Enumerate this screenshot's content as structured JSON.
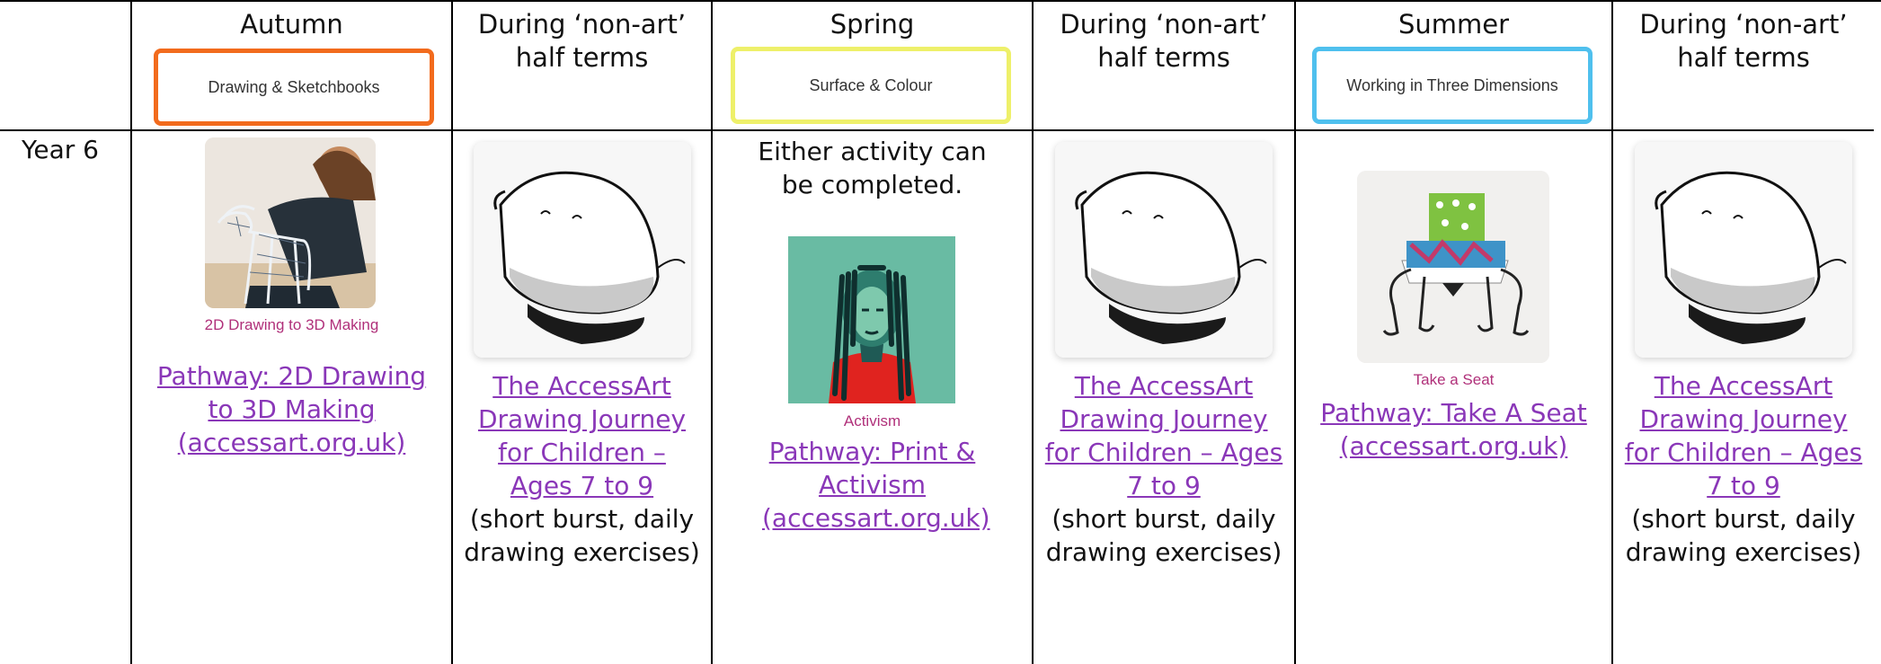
{
  "row_label": "Year 6",
  "columns": [
    {
      "title": "Autumn",
      "badge": "Drawing & Sketchbooks",
      "badge_color": "#f26b1d",
      "image_icon": "girl-with-wire-dog-sculpture",
      "caption": "2D Drawing to 3D Making",
      "link": "Pathway: 2D Drawing to 3D Making (accessart.org.uk)"
    },
    {
      "title": "During ‘non-art’ half terms",
      "image_icon": "ink-drawing-blob",
      "link": "The AccessArt Drawing Journey for Children – Ages 7 to 9",
      "note": "(short burst, daily drawing exercises)"
    },
    {
      "title": "Spring",
      "badge": "Surface & Colour",
      "badge_color": "#eef06a",
      "intro": "Either activity can be completed.",
      "image_icon": "activism-portrait-print",
      "caption": "Activism",
      "link": "Pathway: Print & Activism (accessart.org.uk)"
    },
    {
      "title": "During ‘non-art’ half terms",
      "image_icon": "ink-drawing-blob",
      "link": "The AccessArt Drawing Journey for Children – Ages 7 to 9",
      "note": "(short burst, daily drawing exercises)"
    },
    {
      "title": "Summer",
      "badge": "Working in Three Dimensions",
      "badge_color": "#4fc0ee",
      "image_icon": "miniature-chair-sculpture",
      "caption": "Take a Seat",
      "link": "Pathway: Take A Seat (accessart.org.uk)"
    },
    {
      "title": "During ‘non-art’ half terms",
      "image_icon": "ink-drawing-blob",
      "link": "The AccessArt Drawing Journey for Children – Ages 7 to 9",
      "note": "(short burst, daily drawing exercises)"
    }
  ]
}
